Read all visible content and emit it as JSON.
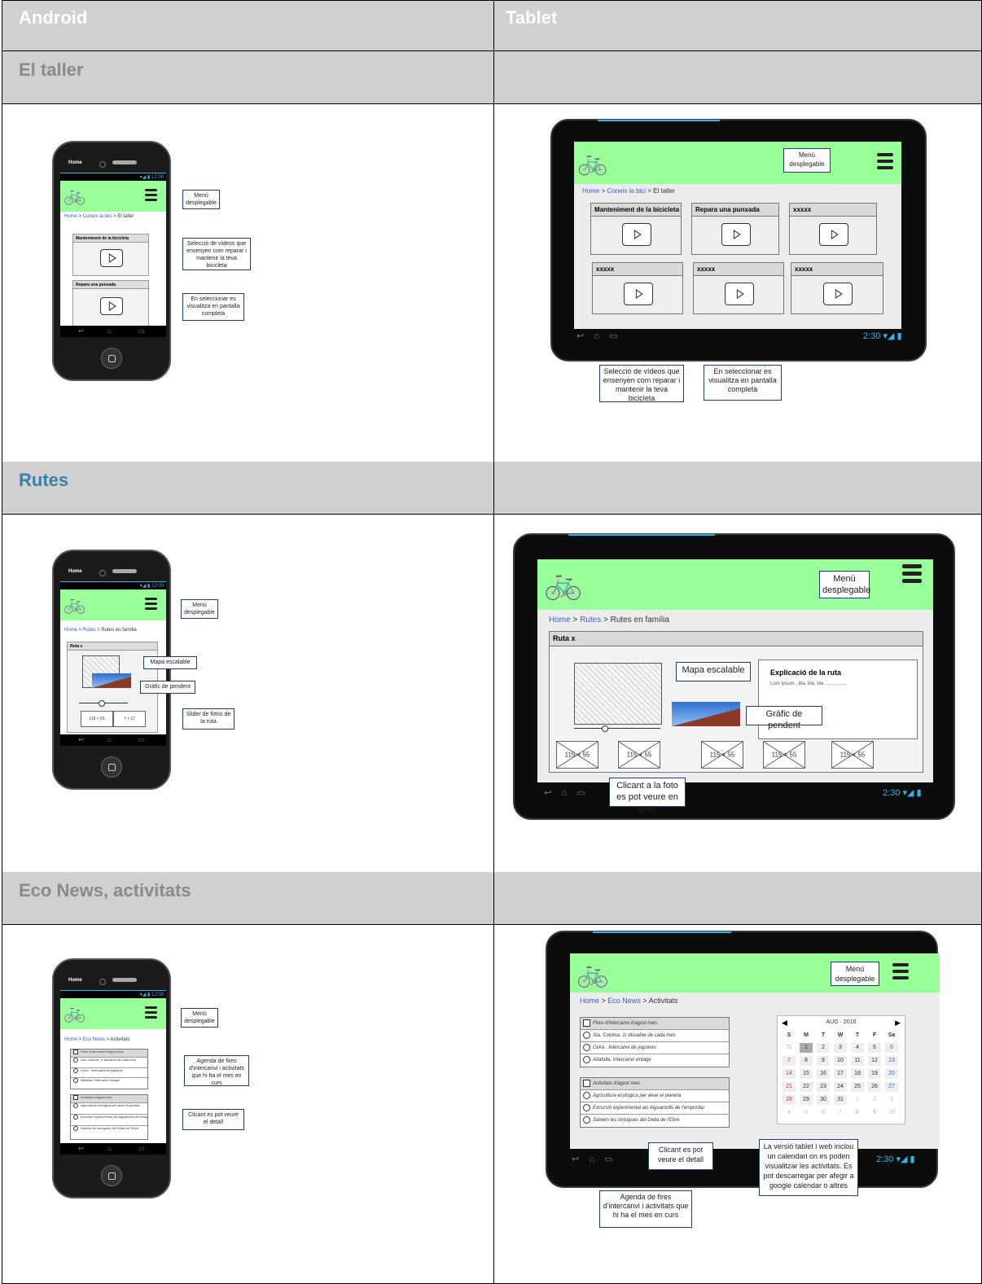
{
  "headers": {
    "android": "Android",
    "tablet": "Tablet"
  },
  "sections": [
    {
      "title": "El taller"
    },
    {
      "title": "Rutes"
    },
    {
      "title": "Eco News, activitats"
    }
  ],
  "phone": {
    "home_label": "Home",
    "status_time": "▾◢ ▮ 12:00"
  },
  "tablet": {
    "status_time": "2:30 ▾◢ ▮"
  },
  "taller": {
    "crumb_home": "Home",
    "crumb_sep1": " > ",
    "crumb_bici": "Coneix la bici",
    "crumb_sep2": " > ",
    "crumb_current": "El taller",
    "cards": [
      "Manteniment de la bicicleta",
      "Repara una punxada",
      "xxxxx",
      "xxxxx",
      "xxxxx",
      "xxxxx"
    ],
    "note_menu": "Menú desplegable",
    "note_videos": "Selecció de vídeos que ensenyen com reparar i mantenir la teva bicicleta",
    "note_fullscreen": "En seleccionar es visualitza en pantalla completa"
  },
  "rutes": {
    "crumb_home": "Home",
    "crumb_sep1": " > ",
    "crumb_rutes": "Rutes",
    "crumb_sep2": " > ",
    "crumb_current": "Rutes en família",
    "card_title": "Ruta x",
    "note_menu": "Menú desplegable",
    "note_map": "Mapa escalable",
    "note_slope": "Gràfic de pendent",
    "note_slider": "Slider de fotos de la ruta",
    "note_photo": "Clicant a la foto es pot veure en gran",
    "thumb_label": "115 × 55",
    "phone_thumb_a": "115 × 55",
    "phone_thumb_b": "7 × 17",
    "explain_title": "Explicació de la ruta",
    "explain_text": "Lore ipsum , bla, bla, bla ................"
  },
  "eco": {
    "crumb_home": "Home",
    "crumb_sep1": " > ",
    "crumb_news": "Eco News",
    "crumb_sep2": " > ",
    "crumb_current": "Activitats",
    "list1_title": "Fires d'intercanvi d'agost mes",
    "list1": [
      "Sta. Coloma. 1r dissabte de cada mes",
      "Celrà . Intercanvi de joguines",
      "Altafulla. Intercanvi vintage"
    ],
    "list2_title": "Activitats d'agost mes",
    "list2": [
      "Agricultura ecologica per alvar el planeta",
      "Excursió experimental als Aiguamolls de l'empordar",
      "Salvem les tortugues del Delta de l'Ebre"
    ],
    "cal_month": "AUG · 2016",
    "cal_days": [
      "S",
      "M",
      "T",
      "W",
      "T",
      "F",
      "Sa"
    ],
    "cal_rows": [
      [
        "31",
        "1",
        "2",
        "3",
        "4",
        "5",
        "6"
      ],
      [
        "7",
        "8",
        "9",
        "10",
        "11",
        "12",
        "13"
      ],
      [
        "14",
        "15",
        "16",
        "17",
        "18",
        "19",
        "20"
      ],
      [
        "21",
        "22",
        "23",
        "24",
        "25",
        "26",
        "27"
      ],
      [
        "28",
        "29",
        "30",
        "31",
        "1",
        "2",
        "3"
      ],
      [
        "4",
        "5",
        "6",
        "7",
        "8",
        "9",
        "10"
      ]
    ],
    "note_menu": "Menú desplegable",
    "note_agenda": "Agenda de fires d'intercanvi i activitats que hi ha el mes en curs",
    "note_detail": "Clicant es pot veure el detall",
    "note_calendar": "La versió tablet i web inclou un calendari on es poden visualitzar les activitats. Es pot descarregar per afegir a google calendar o altres"
  },
  "colors": {
    "accent_green": "#99ff99",
    "link_blue": "#3a5bd9",
    "header_gray": "#d0d0d0",
    "system_blue": "#33b5e5"
  }
}
